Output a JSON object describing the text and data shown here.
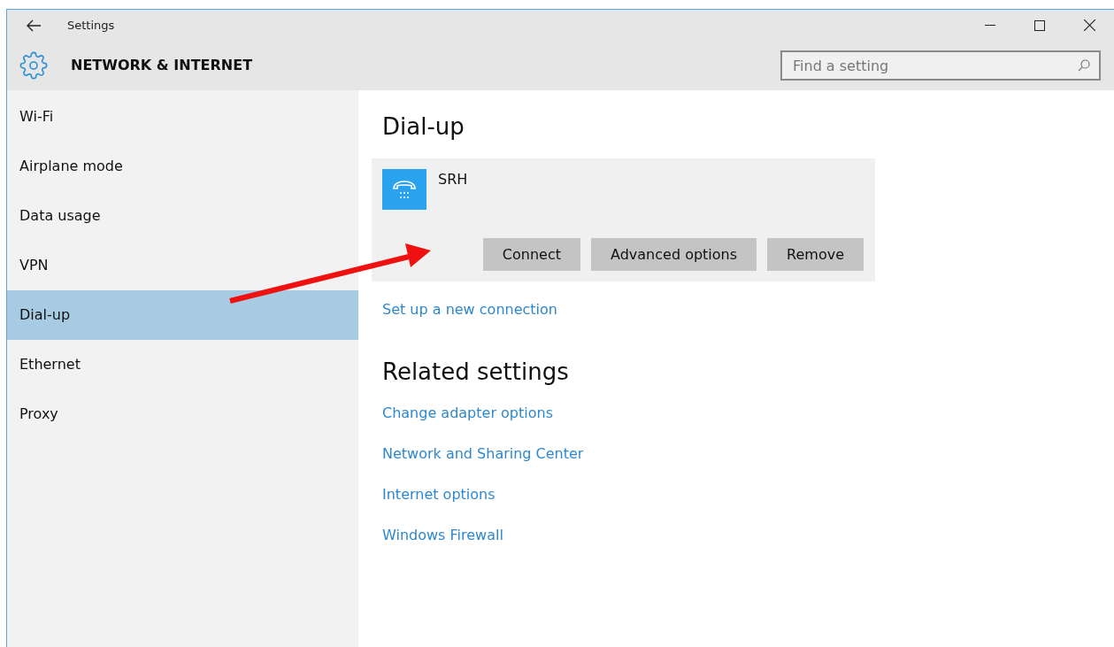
{
  "window": {
    "title": "Settings"
  },
  "header": {
    "title": "NETWORK & INTERNET"
  },
  "search": {
    "placeholder": "Find a setting"
  },
  "sidebar": {
    "items": [
      {
        "label": "Wi-Fi",
        "selected": false
      },
      {
        "label": "Airplane mode",
        "selected": false
      },
      {
        "label": "Data usage",
        "selected": false
      },
      {
        "label": "VPN",
        "selected": false
      },
      {
        "label": "Dial-up",
        "selected": true
      },
      {
        "label": "Ethernet",
        "selected": false
      },
      {
        "label": "Proxy",
        "selected": false
      }
    ]
  },
  "content": {
    "title": "Dial-up",
    "connection": {
      "name": "SRH",
      "buttons": [
        "Connect",
        "Advanced options",
        "Remove"
      ]
    },
    "setup_link": "Set up a new connection",
    "related": {
      "title": "Related settings",
      "links": [
        "Change adapter options",
        "Network and Sharing Center",
        "Internet options",
        "Windows Firewall"
      ]
    }
  }
}
